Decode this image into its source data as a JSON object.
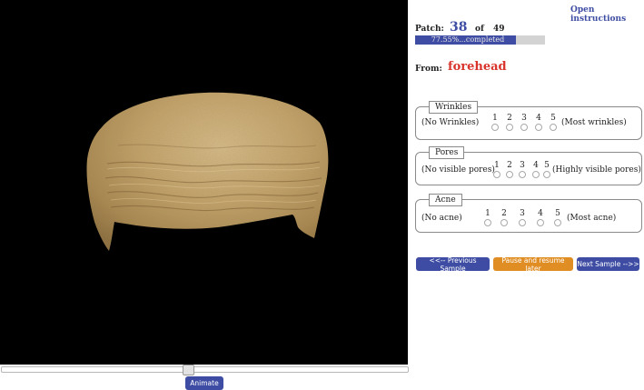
{
  "header": {
    "instructions_link": "Open instructions"
  },
  "patch": {
    "label": "Patch:",
    "current": "38",
    "of_label": "of",
    "total": "49"
  },
  "progress": {
    "percent": 77.55,
    "text": "77.55%...completed",
    "fill_color": "#3e4da3",
    "track_color": "#d3d3d3"
  },
  "source": {
    "label": "From:",
    "value": "forehead",
    "value_color": "#d9342b"
  },
  "questions": [
    {
      "legend": "Wrinkles",
      "left_label": "(No Wrinkles)",
      "right_label": "(Most wrinkles)",
      "options": [
        "1",
        "2",
        "3",
        "4",
        "5"
      ]
    },
    {
      "legend": "Pores",
      "left_label": "(No visible pores)",
      "right_label": "(Highly visible pores)",
      "options": [
        "1",
        "2",
        "3",
        "4",
        "5"
      ]
    },
    {
      "legend": "Acne",
      "left_label": "(No acne)",
      "right_label": "(Most acne)",
      "options": [
        "1",
        "2",
        "3",
        "4",
        "5"
      ]
    }
  ],
  "buttons": {
    "previous": "<<-- Previous Sample",
    "pause": "Pause and resume later",
    "next": "Next Sample -->>",
    "animate": "Animate"
  },
  "viewer": {
    "background": "#000000",
    "slider_position": 0.46
  },
  "icons": {
    "skin_patch": "forehead-skin-3d-mesh"
  }
}
